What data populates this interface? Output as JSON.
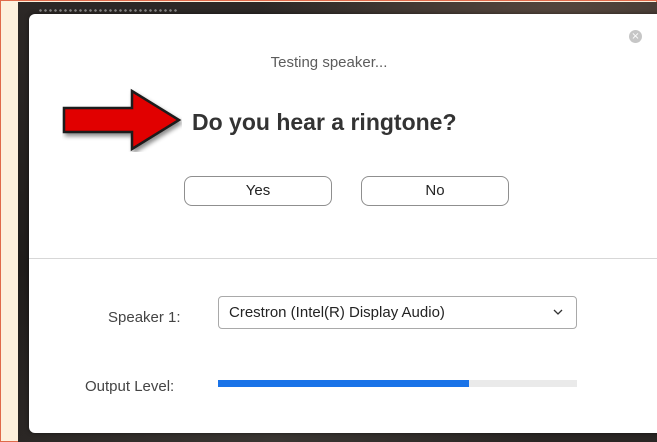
{
  "dialog": {
    "status_text": "Testing speaker...",
    "question": "Do you hear a ringtone?",
    "yes_label": "Yes",
    "no_label": "No",
    "close_glyph": "×"
  },
  "speaker": {
    "label": "Speaker 1:",
    "selected": "Crestron (Intel(R) Display Audio)"
  },
  "output_level": {
    "label": "Output Level:",
    "level_percent": 70
  },
  "icons": {
    "close": "close-icon",
    "dropdown": "chevron-down-icon",
    "annotation": "red-arrow-icon"
  },
  "colors": {
    "accent": "#1a73e8",
    "arrow": "#e10000",
    "page_border": "#e06a4a"
  }
}
